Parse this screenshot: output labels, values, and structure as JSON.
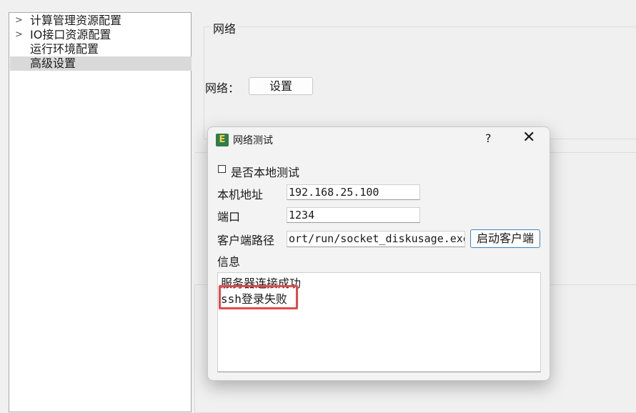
{
  "tree": {
    "items": [
      {
        "label": "计算管理资源配置",
        "expandable": true
      },
      {
        "label": "IO接口资源配置",
        "expandable": true
      },
      {
        "label": "运行环境配置",
        "expandable": false
      },
      {
        "label": "高级设置",
        "expandable": false,
        "selected": true
      }
    ]
  },
  "main": {
    "group_title": "网络",
    "network_label": "网络：",
    "settings_button": "设置"
  },
  "dialog": {
    "title": "网络测试",
    "help": "?",
    "close": "✕",
    "local_test_label": "是否本地测试",
    "local_test_checked": false,
    "host_label": "本机地址",
    "host_value": "192.168.25.100",
    "port_label": "端口",
    "port_value": "1234",
    "client_path_label": "客户端路径",
    "client_path_value": "ort/run/socket_diskusage.exe",
    "start_client_button": "启动客户端",
    "info_label": "信息",
    "info_lines": [
      "服务器连接成功",
      "ssh登录失败"
    ]
  },
  "colors": {
    "highlight": "#e5484d",
    "selected_row": "#d9d9d9",
    "button_focus_border": "#3a87c8"
  }
}
